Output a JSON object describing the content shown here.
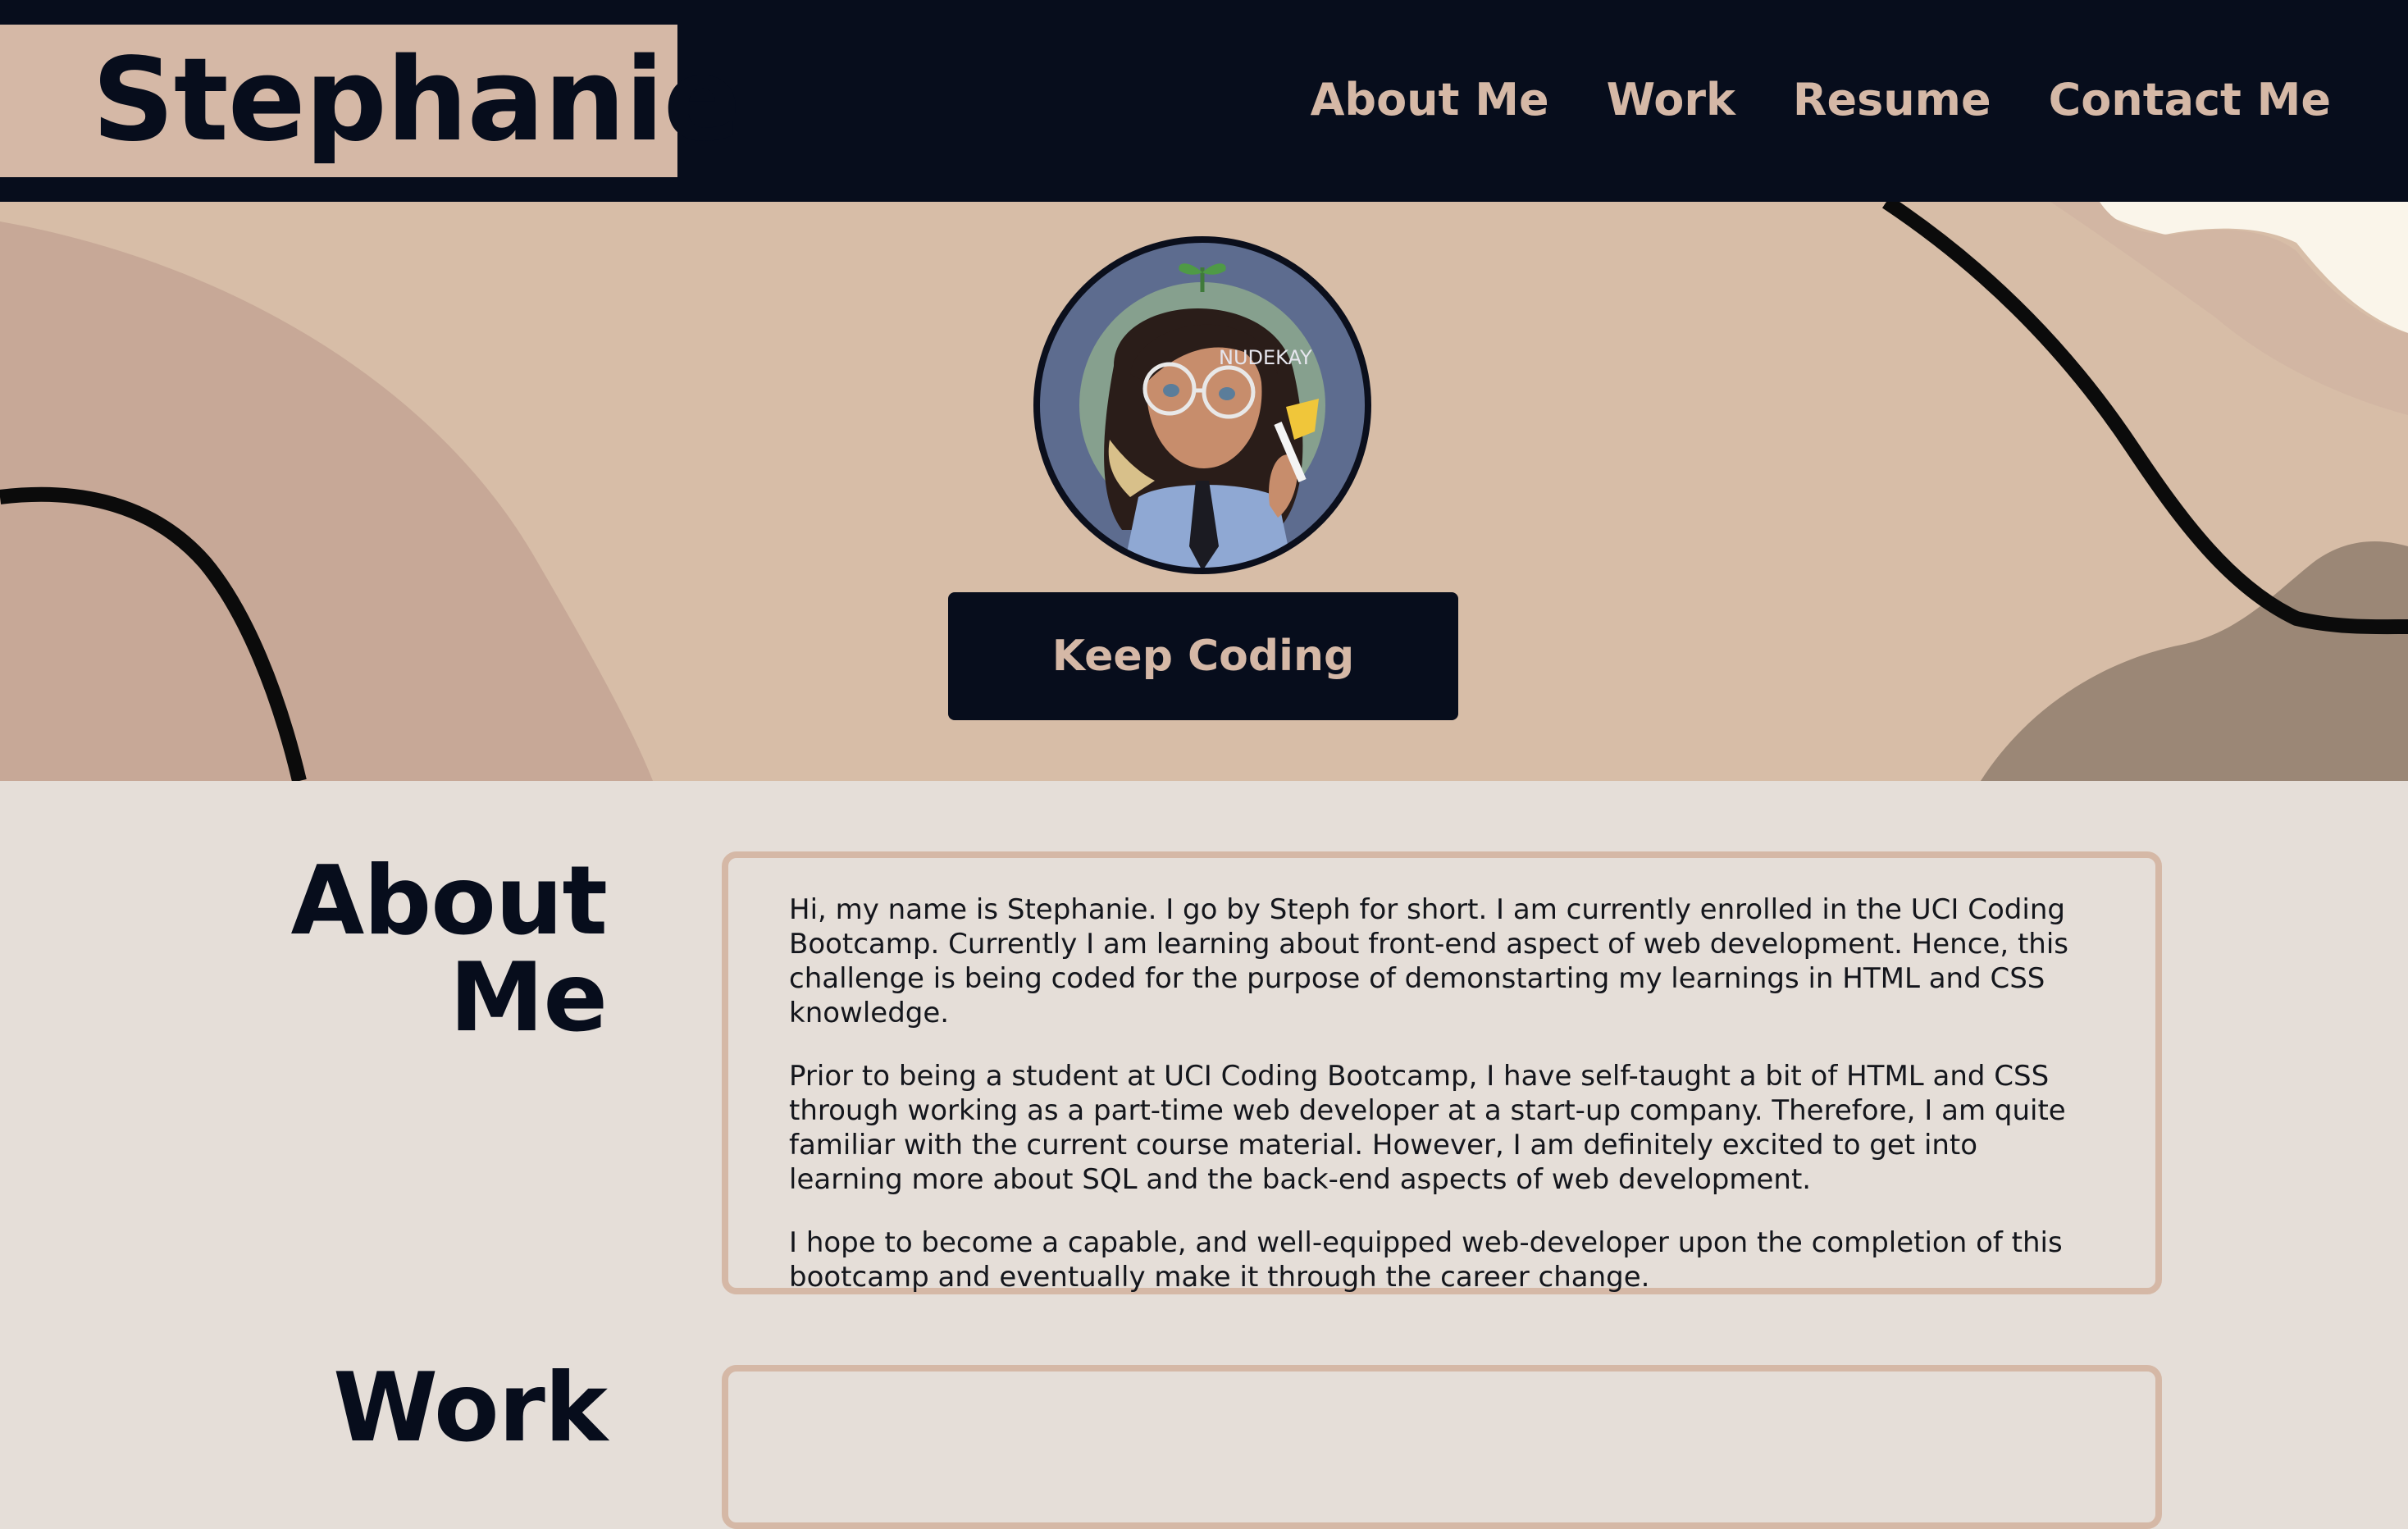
{
  "header": {
    "brand": "Stephanie",
    "nav": [
      "About Me",
      "Work",
      "Resume",
      "Contact Me"
    ]
  },
  "hero": {
    "avatar_watermark": "NUDEKAY",
    "cta_label": "Keep Coding"
  },
  "about": {
    "heading_line1": "About",
    "heading_line2": "Me",
    "paragraphs": [
      "Hi, my name is Stephanie. I go by Steph for short. I am currently enrolled in the UCI Coding Bootcamp. Currently I am learning about front-end aspect of web development. Hence, this challenge is being coded for the purpose of demonstarting my learnings in HTML and CSS knowledge.",
      "Prior to being a student at UCI Coding Bootcamp, I have self-taught a bit of HTML and CSS through working as a part-time web developer at a start-up company. Therefore, I am quite familiar with the current course material. However, I am definitely excited to get into learning more about SQL and the back-end aspects of web development.",
      "I hope to become a capable, and well-equipped web-developer upon the completion of this bootcamp and eventually make it through the career change."
    ]
  },
  "work": {
    "heading": "Work"
  },
  "colors": {
    "navy": "#070d1c",
    "tan": "#d5b8a6",
    "hero": "#d7bda7",
    "page": "#e5ded8"
  }
}
